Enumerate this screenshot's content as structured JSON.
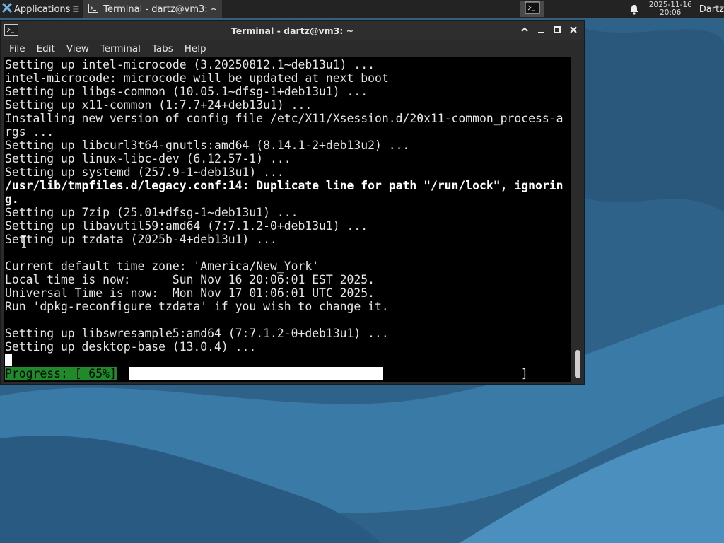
{
  "panel": {
    "applications_label": "Applications",
    "task_label": "Terminal - dartz@vm3: ~",
    "clock_date": "2025-11-16",
    "clock_time": "20:06",
    "user": "Dartz"
  },
  "window": {
    "title": "Terminal - dartz@vm3: ~",
    "menu": [
      "File",
      "Edit",
      "View",
      "Terminal",
      "Tabs",
      "Help"
    ]
  },
  "terminal": {
    "lines": [
      {
        "text": "Setting up intel-microcode (3.20250812.1~deb13u1) ...",
        "bold": false
      },
      {
        "text": "intel-microcode: microcode will be updated at next boot",
        "bold": false
      },
      {
        "text": "Setting up libgs-common (10.05.1~dfsg-1+deb13u1) ...",
        "bold": false
      },
      {
        "text": "Setting up x11-common (1:7.7+24+deb13u1) ...",
        "bold": false
      },
      {
        "text": "Installing new version of config file /etc/X11/Xsession.d/20x11-common_process-a",
        "bold": false
      },
      {
        "text": "rgs ...",
        "bold": false
      },
      {
        "text": "Setting up libcurl3t64-gnutls:amd64 (8.14.1-2+deb13u2) ...",
        "bold": false
      },
      {
        "text": "Setting up linux-libc-dev (6.12.57-1) ...",
        "bold": false
      },
      {
        "text": "Setting up systemd (257.9-1~deb13u1) ...",
        "bold": false
      },
      {
        "text": "/usr/lib/tmpfiles.d/legacy.conf:14: Duplicate line for path \"/run/lock\", ignorin",
        "bold": true
      },
      {
        "text": "g.",
        "bold": true
      },
      {
        "text": "Setting up 7zip (25.01+dfsg-1~deb13u1) ...",
        "bold": false
      },
      {
        "text": "Setting up libavutil59:amd64 (7:7.1.2-0+deb13u1) ...",
        "bold": false
      },
      {
        "text": "Setting up tzdata (2025b-4+deb13u1) ...",
        "bold": false
      },
      {
        "text": "",
        "bold": false
      },
      {
        "text": "Current default time zone: 'America/New_York'",
        "bold": false
      },
      {
        "text": "Local time is now:      Sun Nov 16 20:06:01 EST 2025.",
        "bold": false
      },
      {
        "text": "Universal Time is now:  Mon Nov 17 01:06:01 UTC 2025.",
        "bold": false
      },
      {
        "text": "Run 'dpkg-reconfigure tzdata' if you wish to change it.",
        "bold": false
      },
      {
        "text": "",
        "bold": false
      },
      {
        "text": "Setting up libswresample5:amd64 (7:7.1.2-0+deb13u1) ...",
        "bold": false
      },
      {
        "text": "Setting up desktop-base (13.0.4) ...",
        "bold": false
      }
    ],
    "progress_label": "Progress: [ 65%]",
    "progress_open": "[",
    "progress_close": "]",
    "progress_fraction": 0.65
  },
  "colors": {
    "progress_green": "#1f8a2a",
    "panel_bg": "#232323",
    "desktop_blue": "#2d5e84"
  }
}
